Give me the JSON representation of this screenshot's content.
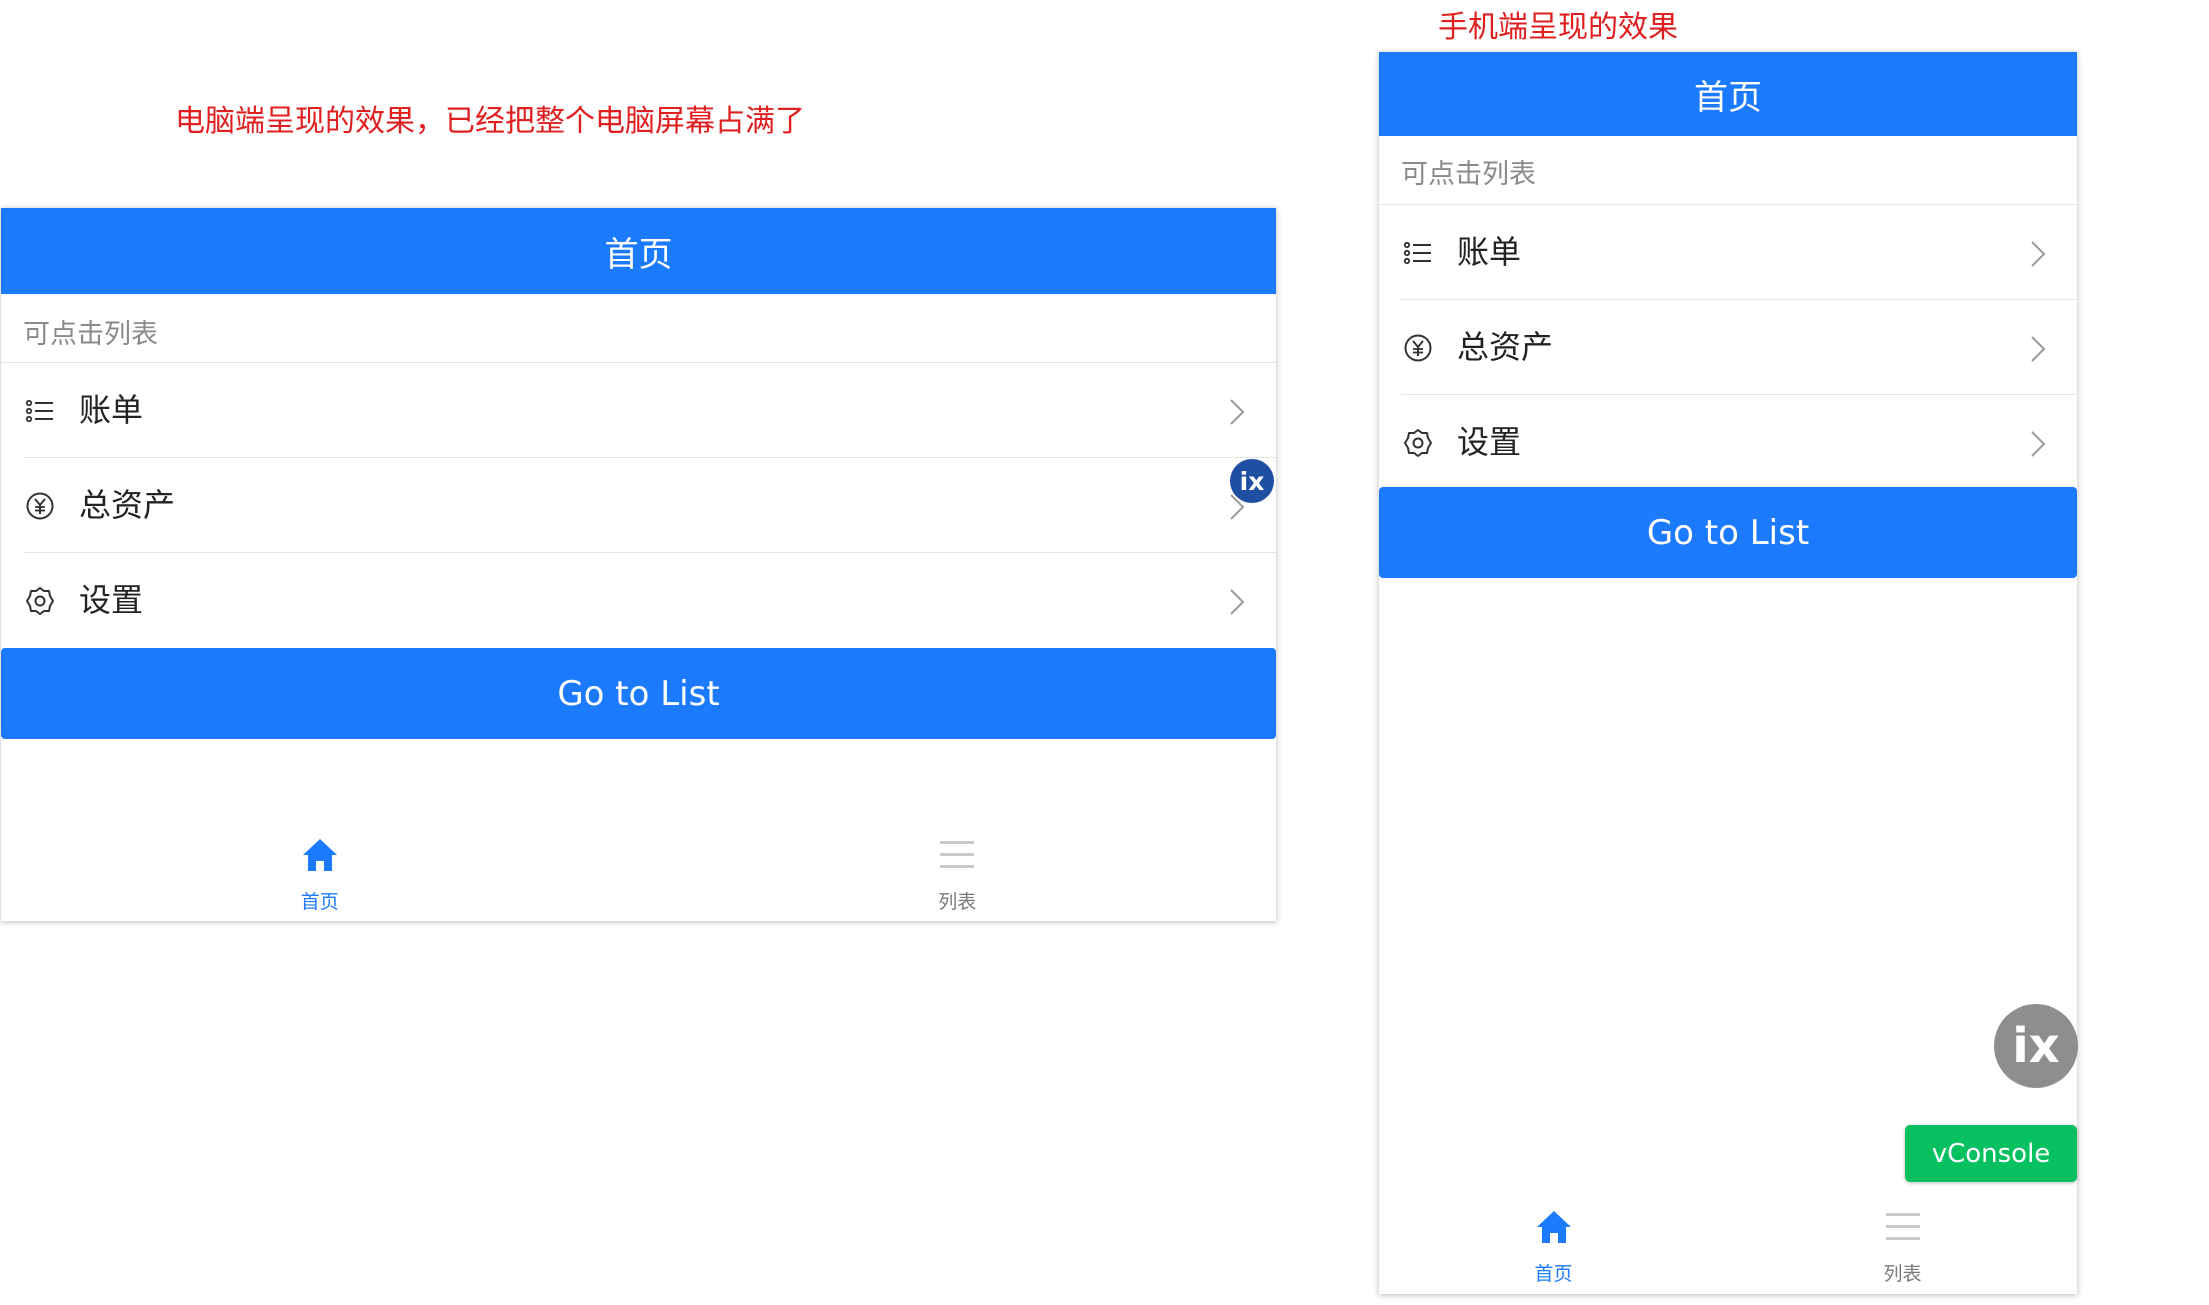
{
  "captions": {
    "pc": "电脑端呈现的效果，已经把整个电脑屏幕占满了",
    "mobile": "手机端呈现的效果"
  },
  "app": {
    "title": "首页",
    "section_title": "可点击列表",
    "cells": [
      {
        "label": "账单",
        "icon": "list-icon"
      },
      {
        "label": "总资产",
        "icon": "yen-icon"
      },
      {
        "label": "设置",
        "icon": "gear-icon"
      }
    ],
    "go_button": "Go to List",
    "tabs": [
      {
        "label": "首页",
        "icon": "home-icon",
        "active": true
      },
      {
        "label": "列表",
        "icon": "menu-icon",
        "active": false
      }
    ]
  },
  "floating": {
    "ix_label": "ix",
    "vconsole_label": "vConsole"
  },
  "colors": {
    "primary": "#1c7aff",
    "caption_red": "#e02020",
    "vconsole_green": "#07c160"
  }
}
